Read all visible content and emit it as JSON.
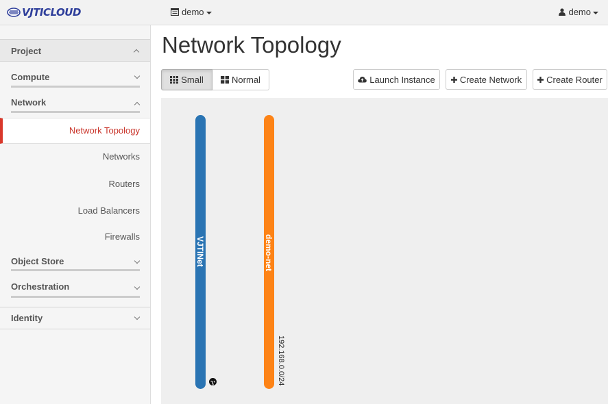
{
  "brand": {
    "name": "VJTICLOUD"
  },
  "topbar": {
    "project_label": "demo",
    "user_label": "demo"
  },
  "sidebar": {
    "project": "Project",
    "groups": {
      "compute": "Compute",
      "network": "Network",
      "object_store": "Object Store",
      "orchestration": "Orchestration"
    },
    "network_items": [
      "Network Topology",
      "Networks",
      "Routers",
      "Load Balancers",
      "Firewalls"
    ],
    "identity": "Identity"
  },
  "main": {
    "title": "Network Topology",
    "toggle": {
      "small": "Small",
      "normal": "Normal",
      "selected": "Small"
    },
    "actions": {
      "launch_instance": "Launch Instance",
      "create_network": "Create Network",
      "create_router": "Create Router"
    }
  },
  "topology": {
    "networks": [
      {
        "name": "VJTINet",
        "color": "#2a74b3",
        "subnet": "",
        "external": true
      },
      {
        "name": "demo-net",
        "color": "#fd8316",
        "subnet": "192.168.0.0/24",
        "external": false
      }
    ]
  },
  "colors": {
    "active_accent": "#d9382b",
    "brand": "#2f3f9b"
  }
}
